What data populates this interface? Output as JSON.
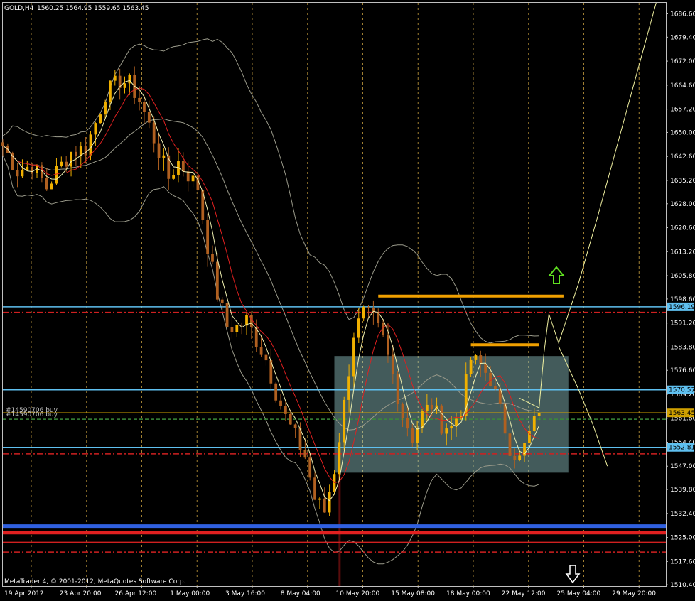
{
  "header": {
    "symbol": "GOLD,H4",
    "ohlc": "1560.25 1564.95 1559.65 1563.45"
  },
  "footer": {
    "copyright": "MetaTrader 4, © 2001-2012, MetaQuotes Software Corp."
  },
  "order_labels": [
    "#14590706 buy",
    "#14590706 buy"
  ],
  "colors": {
    "background": "#000000",
    "grid": "#c8a040",
    "axis_text": "#ffffff",
    "bull_candle": "#f0b000",
    "bear_candle": "#b06020",
    "ma_red": "#e02020",
    "ma_white": "#f0f0b0",
    "bollinger": "#9a9a8a",
    "level_line": "#5fc0f0",
    "zone_fill": "#9fd8d8",
    "bar_orange": "#f0a000",
    "arrow_up": "#60e020",
    "arrow_down": "#ffffff"
  },
  "chart_data": {
    "type": "candlestick",
    "symbol": "GOLD",
    "timeframe": "H4",
    "ylim": [
      1510,
      1690
    ],
    "y_ticks": [
      "1686.60",
      "1679.40",
      "1672.00",
      "1664.60",
      "1657.20",
      "1650.00",
      "1642.60",
      "1635.20",
      "1628.00",
      "1620.60",
      "1613.20",
      "1605.80",
      "1598.60",
      "1591.20",
      "1583.80",
      "1576.60",
      "1569.20",
      "1561.80",
      "1554.40",
      "1547.00",
      "1539.80",
      "1532.40",
      "1525.00",
      "1517.60",
      "1510.40"
    ],
    "x_ticks": [
      "19 Apr 2012",
      "23 Apr 20:00",
      "26 Apr 12:00",
      "1 May 00:00",
      "3 May 16:00",
      "8 May 04:00",
      "10 May 20:00",
      "15 May 08:00",
      "18 May 00:00",
      "22 May 12:00",
      "25 May 04:00",
      "29 May 20:00"
    ],
    "last_price": 1563.45,
    "close_path": [
      [
        0,
        1646
      ],
      [
        3,
        1638
      ],
      [
        6,
        1640
      ],
      [
        9,
        1633
      ],
      [
        11,
        1638
      ],
      [
        14,
        1644
      ],
      [
        17,
        1645
      ],
      [
        19,
        1653
      ],
      [
        21,
        1662
      ],
      [
        24,
        1666
      ],
      [
        26,
        1665
      ],
      [
        28,
        1660
      ],
      [
        30,
        1652
      ],
      [
        32,
        1644
      ],
      [
        34,
        1636
      ],
      [
        36,
        1641
      ],
      [
        38,
        1637
      ],
      [
        40,
        1633
      ],
      [
        42,
        1615
      ],
      [
        44,
        1600
      ],
      [
        46,
        1590
      ],
      [
        48,
        1590
      ],
      [
        50,
        1592
      ],
      [
        52,
        1586
      ],
      [
        54,
        1580
      ],
      [
        56,
        1570
      ],
      [
        58,
        1562
      ],
      [
        60,
        1556
      ],
      [
        62,
        1550
      ],
      [
        64,
        1537
      ],
      [
        66,
        1533
      ],
      [
        68,
        1546
      ],
      [
        70,
        1566
      ],
      [
        72,
        1588
      ],
      [
        74,
        1594
      ],
      [
        76,
        1592
      ],
      [
        78,
        1586
      ],
      [
        80,
        1575
      ],
      [
        82,
        1563
      ],
      [
        84,
        1556
      ],
      [
        86,
        1563
      ],
      [
        88,
        1566
      ],
      [
        90,
        1560
      ],
      [
        92,
        1559
      ],
      [
        94,
        1565
      ],
      [
        96,
        1580
      ],
      [
        98,
        1578
      ],
      [
        100,
        1574
      ],
      [
        102,
        1564
      ],
      [
        104,
        1553
      ],
      [
        106,
        1549
      ],
      [
        108,
        1557
      ],
      [
        110,
        1563.45
      ]
    ],
    "indicators": [
      "Moving Average (red)",
      "Moving Average (light)",
      "Bollinger Bands"
    ],
    "horizontal_levels": [
      {
        "price": 1596.19,
        "label": "1596.19",
        "color": "#5fc0f0",
        "style": "solid"
      },
      {
        "price": 1570.57,
        "label": "1570.57",
        "color": "#5fc0f0",
        "style": "solid"
      },
      {
        "price": 1552.81,
        "label": "1552.81",
        "color": "#5fc0f0",
        "style": "solid"
      },
      {
        "price": 1563.45,
        "label": "1563.45",
        "color": "#d0a000",
        "style": "solid"
      },
      {
        "price": 1594.5,
        "label": "",
        "color": "#d02020",
        "style": "dashdot"
      },
      {
        "price": 1550.8,
        "label": "",
        "color": "#d02020",
        "style": "dashdot"
      },
      {
        "price": 1520.5,
        "label": "",
        "color": "#d02020",
        "style": "dashdot"
      },
      {
        "price": 1561.5,
        "label": "",
        "color": "#3a8a3a",
        "style": "dashed"
      },
      {
        "price": 1523.5,
        "label": "",
        "color": "#d02020",
        "style": "solid"
      },
      {
        "price": 1528.5,
        "label": "",
        "color": "#3060e0",
        "style": "thick"
      },
      {
        "price": 1526.5,
        "label": "",
        "color": "#e02020",
        "style": "thick"
      }
    ],
    "zone": {
      "price_high": 1581,
      "price_low": 1545,
      "x_start": 68,
      "x_end": 116
    },
    "resistance_bars": [
      {
        "price": 1599.5,
        "x_start": 77,
        "x_end": 115
      },
      {
        "price": 1584.5,
        "x_start": 96,
        "x_end": 110
      }
    ],
    "projection_path": [
      [
        106,
        1568
      ],
      [
        110,
        1565
      ],
      [
        111,
        1582
      ],
      [
        112,
        1594
      ],
      [
        114,
        1585
      ],
      [
        118,
        1603
      ],
      [
        122,
        1624
      ],
      [
        134,
        1690
      ]
    ],
    "secondary_projection": [
      [
        114,
        1584
      ],
      [
        118,
        1571
      ],
      [
        121,
        1560
      ],
      [
        124,
        1547
      ]
    ],
    "grid": true,
    "legend": "none"
  }
}
